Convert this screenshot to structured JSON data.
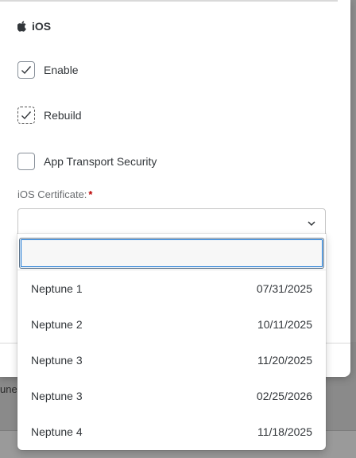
{
  "background": {
    "strip_text": "une",
    "bottom_mark": ""
  },
  "section": {
    "title": "iOS",
    "icon": "apple-icon"
  },
  "checkboxes": [
    {
      "label": "Enable",
      "checked": true
    },
    {
      "label": "Rebuild",
      "checked": true,
      "focused": true
    },
    {
      "label": "App Transport Security",
      "checked": false
    }
  ],
  "certificate": {
    "label": "iOS Certificate:",
    "required_marker": "*",
    "value": "",
    "search_value": "",
    "options": [
      {
        "name": "Neptune 1",
        "date": "07/31/2025"
      },
      {
        "name": "Neptune 2",
        "date": "10/11/2025"
      },
      {
        "name": "Neptune 3",
        "date": "11/20/2025"
      },
      {
        "name": "Neptune 3",
        "date": "02/25/2026"
      },
      {
        "name": "Neptune 4",
        "date": "11/18/2025"
      }
    ]
  },
  "colors": {
    "required": "#bb0000",
    "focus": "#0a6ed1",
    "text": "#32363a"
  }
}
